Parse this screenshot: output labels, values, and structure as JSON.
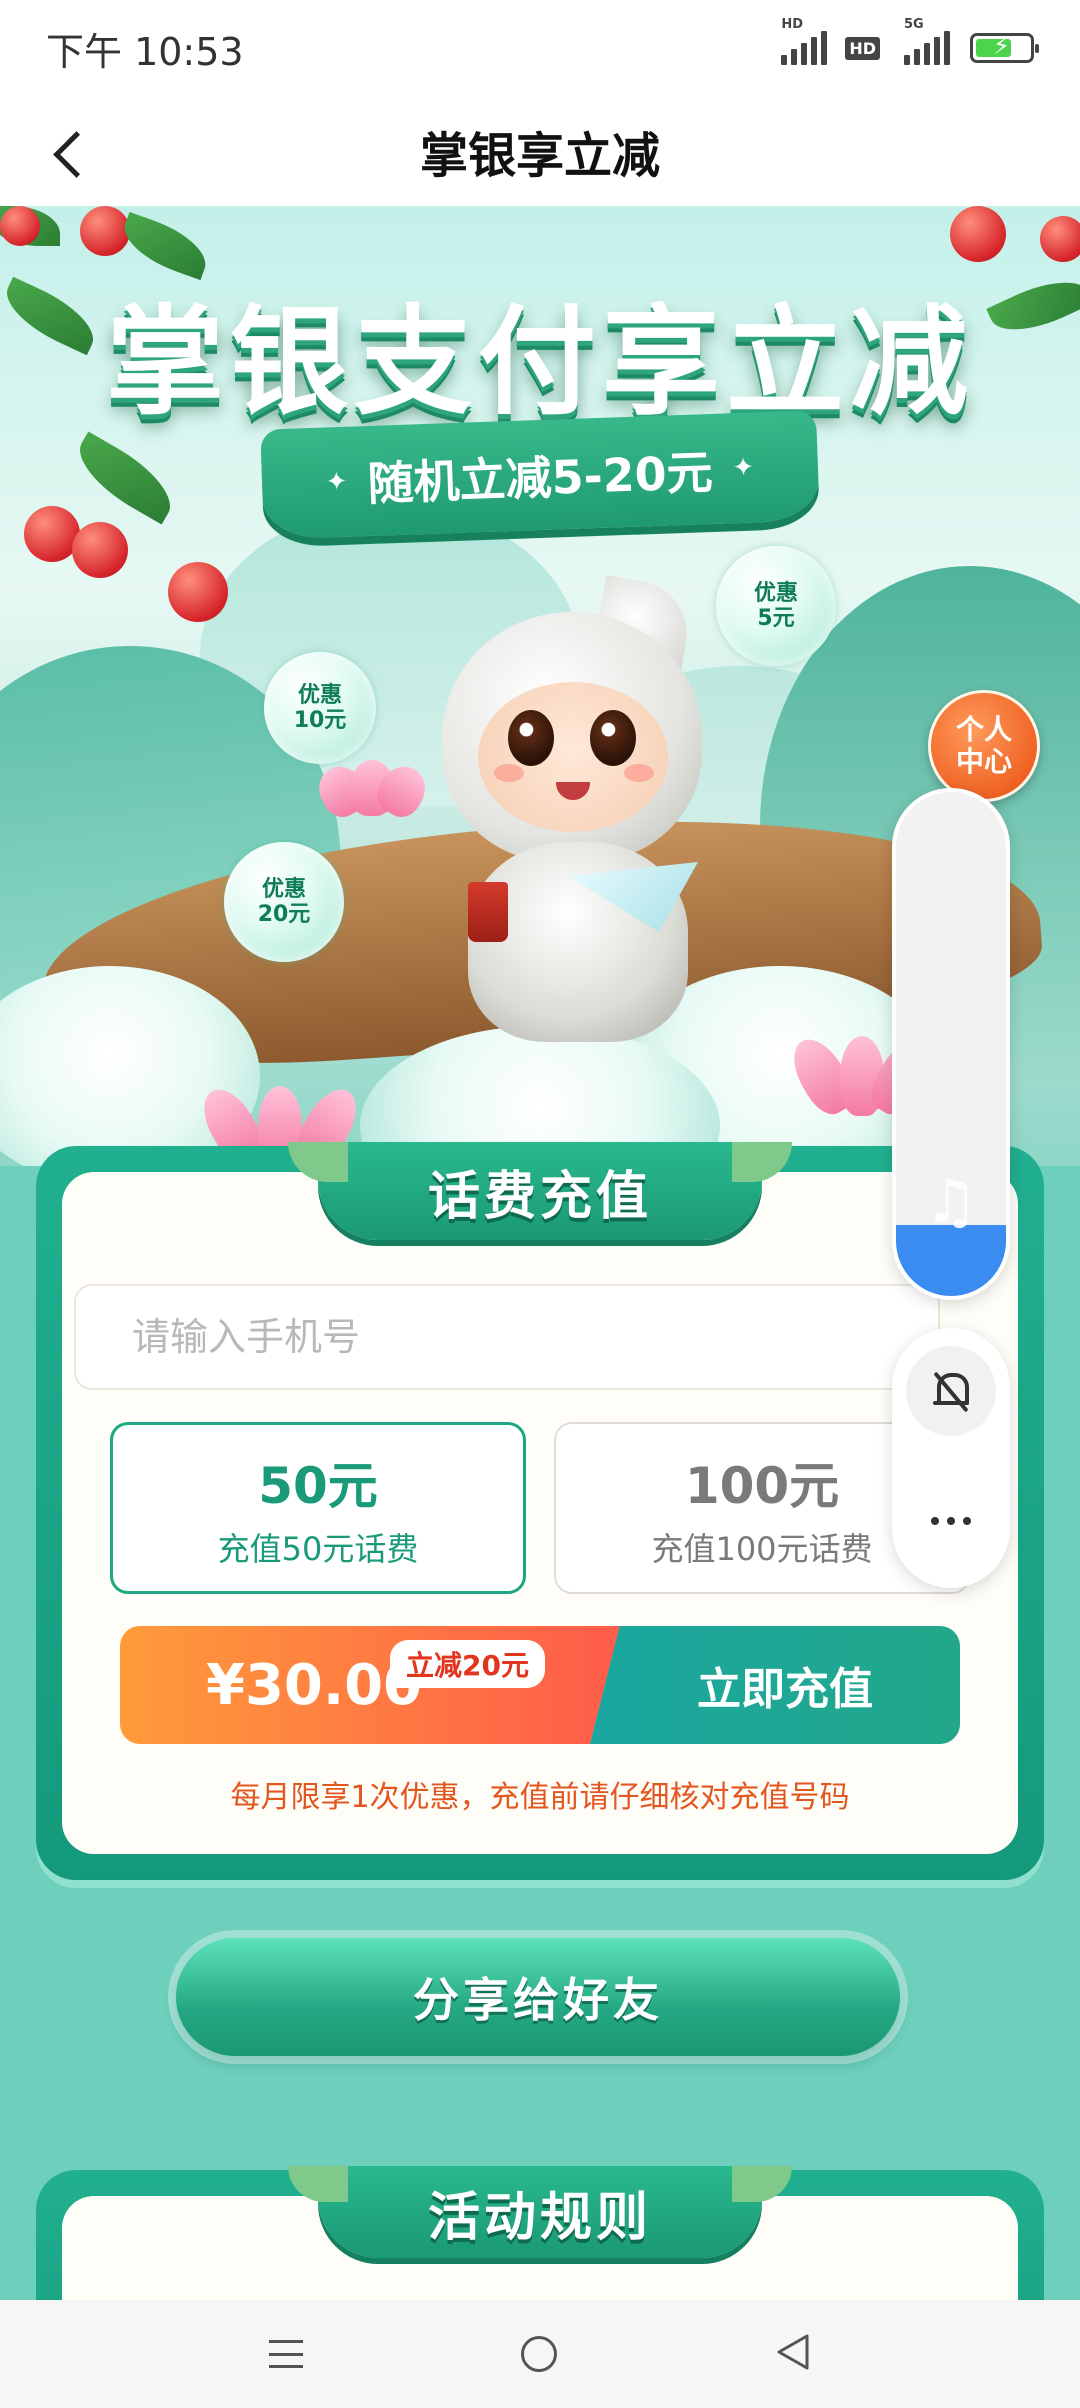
{
  "status_bar": {
    "time": "下午 10:53",
    "signal1_tag": "HD",
    "hd_badge": "HD",
    "signal2_tag": "5G",
    "battery_icon": "battery-charging-icon"
  },
  "title_bar": {
    "title": "掌银享立减",
    "back_icon": "back-arrow-icon"
  },
  "hero": {
    "headline": "掌银支付享立减",
    "ribbon_text": "随机立减5-20元",
    "bubbles": [
      {
        "label": "优惠\n5元"
      },
      {
        "label": "优惠\n10元"
      },
      {
        "label": "优惠\n20元"
      }
    ],
    "personal_center": "个人\n中心"
  },
  "recharge": {
    "title": "话费充值",
    "phone_placeholder": "请输入手机号",
    "phone_value": "",
    "options": [
      {
        "amount": "50元",
        "desc": "充值50元话费",
        "selected": true
      },
      {
        "amount": "100元",
        "desc": "充值100元话费",
        "selected": false
      }
    ],
    "price": "¥30.00",
    "discount_tag": "立减20元",
    "pay_button": "立即充值",
    "notice": "每月限享1次优惠，充值前请仔细核对充值号码"
  },
  "share": {
    "button": "分享给好友"
  },
  "rules": {
    "title": "活动规则"
  },
  "floating": {
    "volume_level": 0.14,
    "music_icon": "music-note-icon",
    "mute_icon": "bell-off-icon",
    "more_icon": "more-dots-icon"
  },
  "colors": {
    "brand_green": "#1da884",
    "price_orange": "#ff7a3f",
    "notice_orange": "#e2561f",
    "volume_blue": "#3a8cf0",
    "page_bg": "#6ecfbd"
  },
  "nav": {
    "menu_icon": "menu-icon",
    "home_icon": "home-circle-icon",
    "back_icon": "triangle-back-icon"
  }
}
